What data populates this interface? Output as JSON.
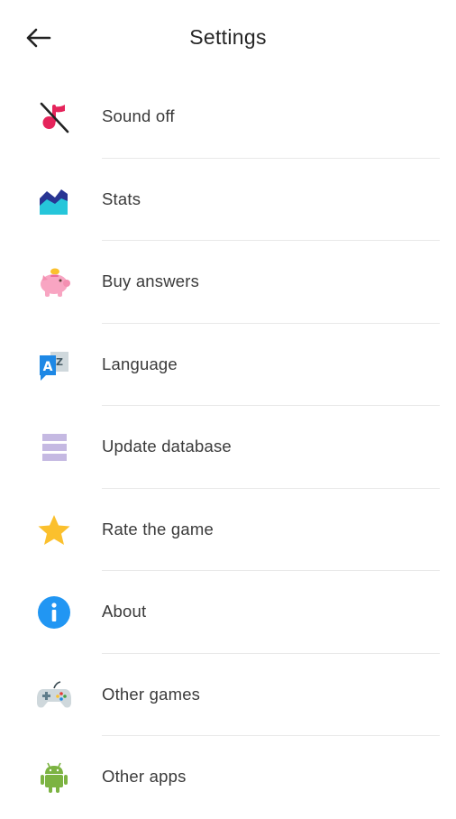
{
  "header": {
    "title": "Settings",
    "back_icon": "arrow-left-icon"
  },
  "items": [
    {
      "label": "Sound off",
      "icon": "sound-off-icon",
      "color": "#e5245b"
    },
    {
      "label": "Stats",
      "icon": "stats-icon",
      "color": "#1e88e5"
    },
    {
      "label": "Buy answers",
      "icon": "piggy-bank-icon",
      "color": "#f8a5c2"
    },
    {
      "label": "Language",
      "icon": "translate-icon",
      "color": "#1e88e5"
    },
    {
      "label": "Update database",
      "icon": "database-icon",
      "color": "#c5b9e2"
    },
    {
      "label": "Rate the game",
      "icon": "star-icon",
      "color": "#fbc02d"
    },
    {
      "label": "About",
      "icon": "info-icon",
      "color": "#2196f3"
    },
    {
      "label": "Other games",
      "icon": "gamepad-icon",
      "color": "#b0bec5"
    },
    {
      "label": "Other apps",
      "icon": "android-icon",
      "color": "#7cb342"
    }
  ]
}
